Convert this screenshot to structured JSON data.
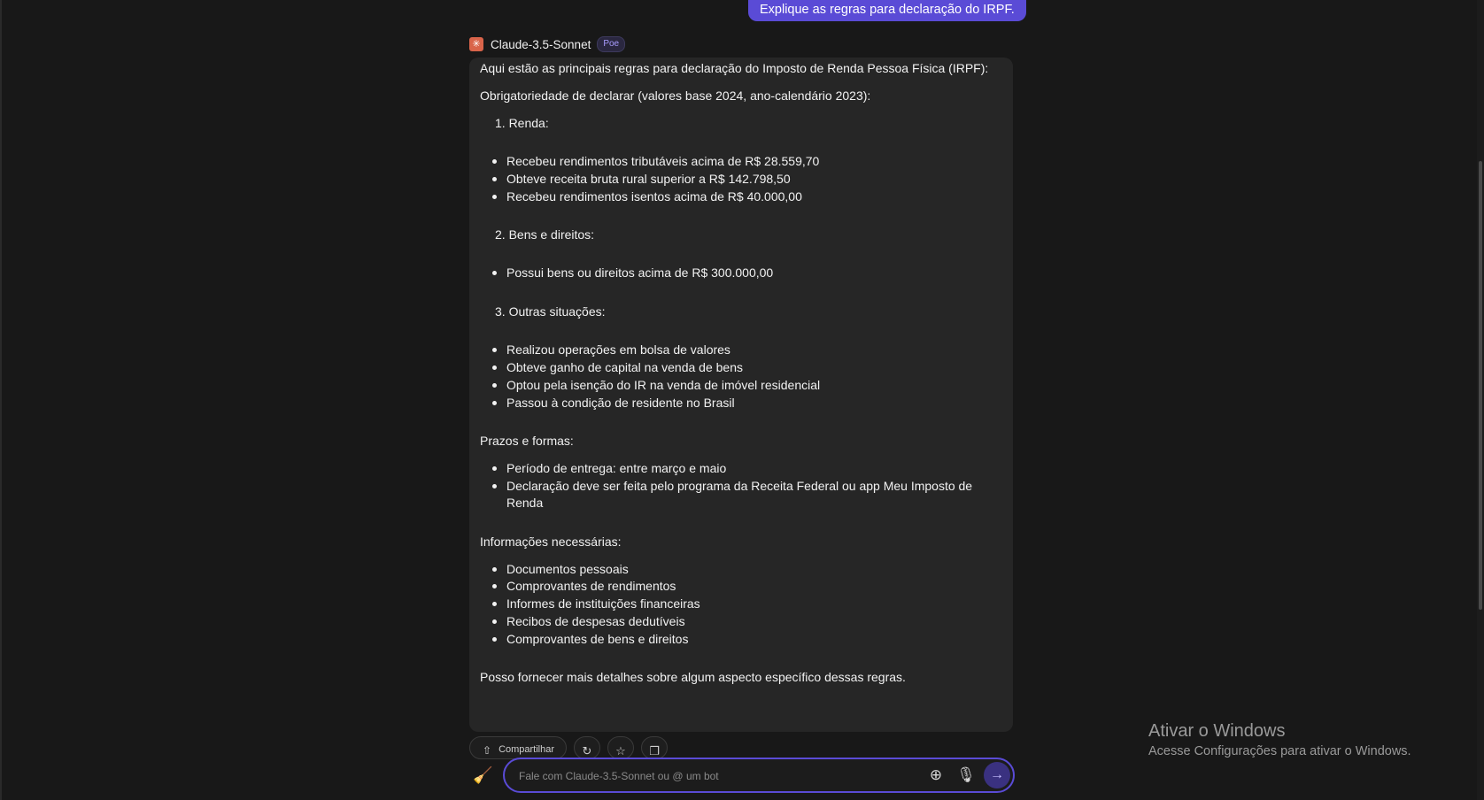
{
  "user_message": "Explique as regras para declaração do IRPF.",
  "bot": {
    "name": "Claude-3.5-Sonnet",
    "badge": "Poe",
    "avatar_icon": "asterisk-icon"
  },
  "response": {
    "intro": "Aqui estão as principais regras para declaração do Imposto de Renda Pessoa Física (IRPF):",
    "obrigatoriedade_heading": "Obrigatoriedade de declarar (valores base 2024, ano-calendário 2023):",
    "sections": [
      {
        "heading": "1. Renda:",
        "items": [
          "Recebeu rendimentos tributáveis acima de R$ 28.559,70",
          "Obteve receita bruta rural superior a R$ 142.798,50",
          "Recebeu rendimentos isentos acima de R$ 40.000,00"
        ]
      },
      {
        "heading": "2. Bens e direitos:",
        "items": [
          "Possui bens ou direitos acima de R$ 300.000,00"
        ]
      },
      {
        "heading": "3. Outras situações:",
        "items": [
          "Realizou operações em bolsa de valores",
          "Obteve ganho de capital na venda de bens",
          "Optou pela isenção do IR na venda de imóvel residencial",
          "Passou à condição de residente no Brasil"
        ]
      }
    ],
    "prazos_heading": "Prazos e formas:",
    "prazos_items": [
      "Período de entrega: entre março e maio",
      "Declaração deve ser feita pelo programa da Receita Federal ou app Meu Imposto de",
      "Renda"
    ],
    "info_heading": "Informações necessárias:",
    "info_items": [
      "Documentos pessoais",
      "Comprovantes de rendimentos",
      "Informes de instituições financeiras",
      "Recibos de despesas dedutíveis",
      "Comprovantes de bens e direitos"
    ],
    "closing": "Posso fornecer mais detalhes sobre algum aspecto específico dessas regras."
  },
  "actions": {
    "share_label": "Compartilhar"
  },
  "composer": {
    "placeholder": "Fale com Claude-3.5-Sonnet ou @ um bot"
  },
  "windows_watermark": {
    "title": "Ativar o Windows",
    "subtitle": "Acesse Configurações para ativar o Windows."
  }
}
